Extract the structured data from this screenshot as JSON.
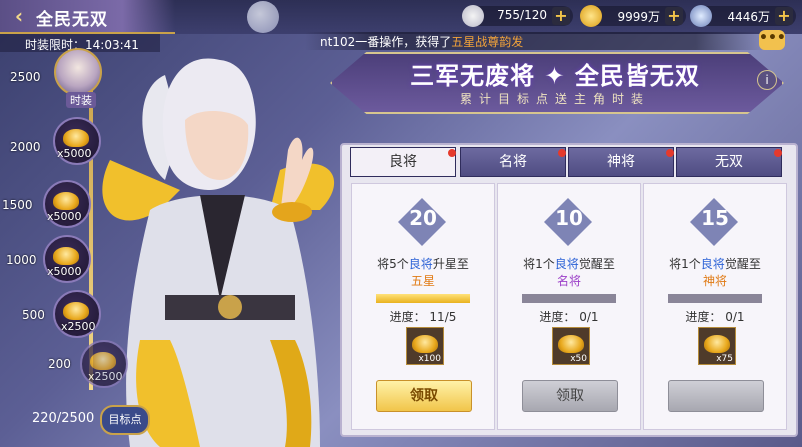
{
  "header": {
    "title": "全民无双",
    "back_icon": "back-arrow-icon",
    "resources": [
      {
        "icon": "stamina-icon",
        "value": "755/120"
      },
      {
        "icon": "gold-ingot-icon",
        "value": "9999万"
      },
      {
        "icon": "silver-icon",
        "value": "4446万"
      }
    ]
  },
  "timer": {
    "label": "时装限时：",
    "value": "14:03:41"
  },
  "marquee": {
    "prefix": "nt102一番操作，获得了",
    "highlight": "五星战尊韵发"
  },
  "chat_icon": "chat-bubble-icon",
  "banner": {
    "title": "三军无废将 ✦ 全民皆无双",
    "subtitle": "累计目标点送主角时装"
  },
  "track": {
    "top_tier": "2500",
    "top_reward_label": "时装",
    "tiers": [
      {
        "points": "2000",
        "qty": "x5000"
      },
      {
        "points": "1500",
        "qty": "x5000"
      },
      {
        "points": "1000",
        "qty": "x5000"
      },
      {
        "points": "500",
        "qty": "x2500"
      },
      {
        "points": "200",
        "qty": "x2500"
      }
    ],
    "progress": "220/2500",
    "target_button": "目标点"
  },
  "tabs": [
    "良将",
    "名将",
    "神将",
    "无双"
  ],
  "cards": [
    {
      "points": "20",
      "desc_a": "将5个",
      "desc_hl": "良将",
      "desc_b": "升星至",
      "target": "五星",
      "progress": "进度：  11/5",
      "fill": 1.0,
      "reward_qty": "x100",
      "claim": "领取"
    },
    {
      "points": "10",
      "desc_a": "将1个",
      "desc_hl": "良将",
      "desc_b": "觉醒至",
      "target": "名将",
      "progress": "进度：  0/1",
      "fill": 0.0,
      "reward_qty": "x50",
      "claim": "领取"
    },
    {
      "points": "15",
      "desc_a": "将1个",
      "desc_hl": "良将",
      "desc_b": "觉醒至",
      "target": "神将",
      "progress": "进度：  0/1",
      "fill": 0.0,
      "reward_qty": "x75",
      "claim": ""
    }
  ]
}
